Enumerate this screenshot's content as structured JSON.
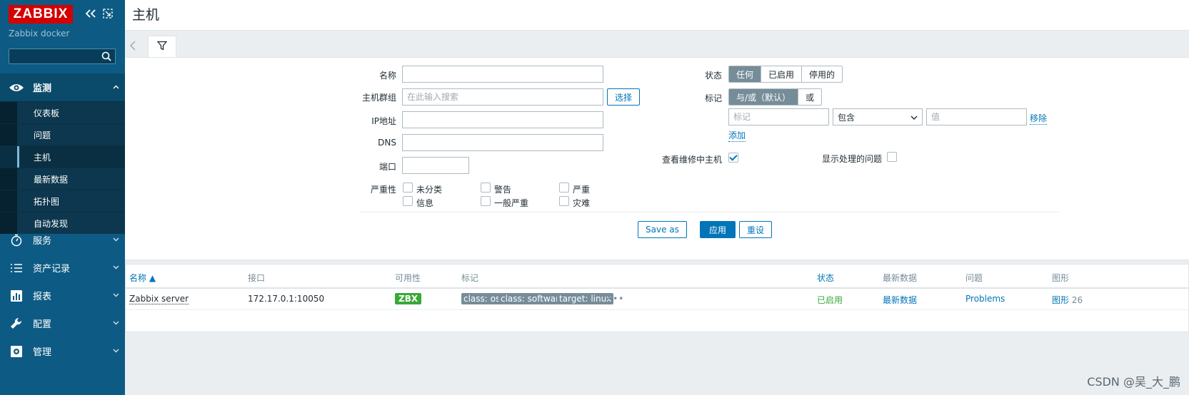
{
  "sidebar": {
    "logo": "ZABBIX",
    "subtitle": "Zabbix docker",
    "search_value": "",
    "menus": [
      {
        "label": "监测",
        "icon": "eye-icon",
        "chevron": "^"
      },
      {
        "label": "服务",
        "icon": "stopwatch-icon",
        "chevron": "v"
      },
      {
        "label": "资产记录",
        "icon": "list-icon",
        "chevron": "v"
      },
      {
        "label": "报表",
        "icon": "bar-chart-icon",
        "chevron": "v"
      },
      {
        "label": "配置",
        "icon": "wrench-icon",
        "chevron": "v"
      },
      {
        "label": "管理",
        "icon": "gear-icon",
        "chevron": "v"
      }
    ],
    "monitor_items": [
      "仪表板",
      "问题",
      "主机",
      "最新数据",
      "拓扑图",
      "自动发现"
    ],
    "active_item": "主机"
  },
  "header": {
    "title": "主机"
  },
  "filter": {
    "name_label": "名称",
    "hostgroup_label": "主机群组",
    "hostgroup_placeholder": "在此输入搜索",
    "select_button": "选择",
    "ip_label": "IP地址",
    "dns_label": "DNS",
    "port_label": "端口",
    "severity_label": "严重性",
    "severities": [
      "未分类",
      "警告",
      "严重",
      "信息",
      "一般严重",
      "灾难"
    ],
    "status_label": "状态",
    "status_options": [
      "任何",
      "已启用",
      "停用的"
    ],
    "tags_label": "标记",
    "tags_options": [
      "与/或（默认）",
      "或"
    ],
    "tag_placeholder": "标记",
    "tag_operator": "包含",
    "value_placeholder": "值",
    "remove_link": "移除",
    "add_link": "添加",
    "maintenance_label": "查看维修中主机",
    "show_suppressed_label": "显示处理的问题",
    "save_as": "Save as",
    "apply": "应用",
    "reset": "重设"
  },
  "table": {
    "headers": {
      "name": "名称 ▲",
      "interface": "接口",
      "availability": "可用性",
      "tags": "标记",
      "status": "状态",
      "latest": "最新数据",
      "problems": "问题",
      "graphs": "图形"
    },
    "rows": [
      {
        "name": "Zabbix server",
        "interface": "172.17.0.1:10050",
        "availability": "ZBX",
        "tags": [
          "class: os",
          "class: software",
          "target: linux"
        ],
        "more": "•••",
        "status": "已启用",
        "latest": "最新数据",
        "problems": "Problems",
        "graphs_label": "图形",
        "graphs_count": "26"
      }
    ]
  },
  "watermark": "CSDN @吴_大_鹏",
  "colors": {
    "sidebar": "#0d5b84",
    "accent": "#0275b8",
    "logo": "#d40000",
    "ok": "#3aa83a"
  }
}
